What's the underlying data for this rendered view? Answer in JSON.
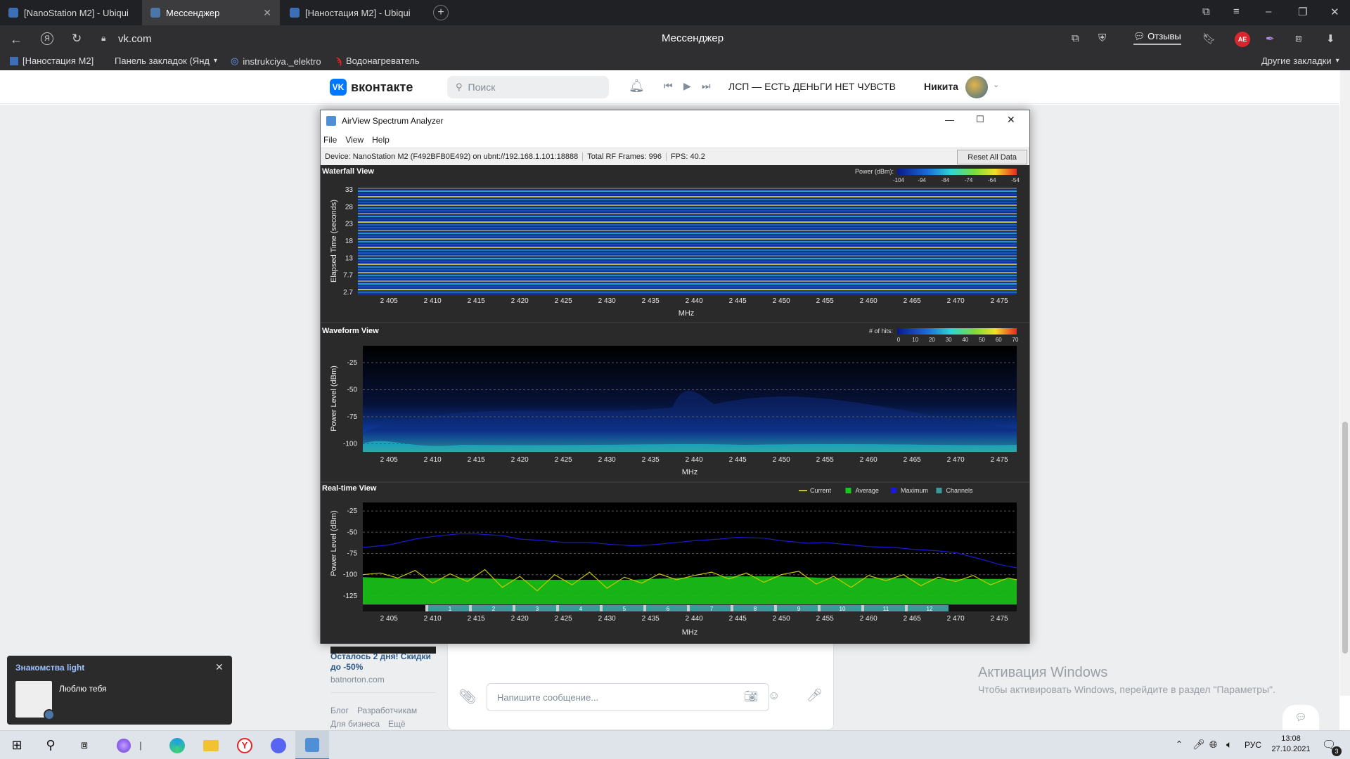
{
  "browser": {
    "tabs": [
      {
        "label": "[NanoStation M2] - Ubiqui",
        "active": false
      },
      {
        "label": "Мессенджер",
        "active": true
      },
      {
        "label": "[Наностация M2] - Ubiqui",
        "active": false
      }
    ],
    "address": "vk.com",
    "page_title": "Мессенджер",
    "feedback": "Отзывы",
    "badge": "AE",
    "bookmarks": [
      "[Наностация M2]",
      "Панель закладок (Янд",
      "instrukciya._elektro",
      "Водонагреватель"
    ],
    "other_bookmarks": "Другие закладки"
  },
  "vk": {
    "logo": "вконтакте",
    "search_placeholder": "Поиск",
    "track": "ЛСП — ЕСТЬ ДЕНЬГИ НЕТ ЧУВСТВ",
    "user_name": "Никита",
    "ad_title": "Осталось 2 дня! Скидки до -50%",
    "ad_domain": "batnorton.com",
    "footer": [
      "Блог",
      "Разработчикам",
      "Для бизнеса",
      "Ещё"
    ],
    "message_placeholder": "Напишите сообщение..."
  },
  "app": {
    "title": "AirView Spectrum Analyzer",
    "menu": [
      "File",
      "View",
      "Help"
    ],
    "device": "Device: NanoStation M2 (F492BFB0E492) on ubnt://192.168.1.101:18888",
    "frames": "Total RF Frames: 996",
    "fps": "FPS: 40.2",
    "reset": "Reset All Data",
    "waterfall_title": "Waterfall View",
    "waveform_title": "Waveform View",
    "realtime_title": "Real-time View",
    "power_label": "Power (dBm):",
    "hits_label": "# of hits:",
    "mhz": "MHz"
  },
  "chart_data": [
    {
      "type": "heatmap",
      "title": "Waterfall View",
      "xlabel": "MHz",
      "ylabel": "Elapsed Time (seconds)",
      "x_ticks": [
        "2 405",
        "2 410",
        "2 415",
        "2 420",
        "2 425",
        "2 430",
        "2 435",
        "2 440",
        "2 445",
        "2 450",
        "2 455",
        "2 460",
        "2 465",
        "2 470",
        "2 475"
      ],
      "y_ticks": [
        "33",
        "28",
        "23",
        "18",
        "13",
        "7.7",
        "2.7"
      ],
      "legend_label": "Power (dBm):",
      "legend_ticks": [
        "-104",
        "-94",
        "-84",
        "-74",
        "-64",
        "-54"
      ]
    },
    {
      "type": "heatmap",
      "title": "Waveform View",
      "xlabel": "MHz",
      "ylabel": "Power Level (dBm)",
      "x_ticks": [
        "2 405",
        "2 410",
        "2 415",
        "2 420",
        "2 425",
        "2 430",
        "2 435",
        "2 440",
        "2 445",
        "2 450",
        "2 455",
        "2 460",
        "2 465",
        "2 470",
        "2 475"
      ],
      "y_ticks": [
        "-25",
        "-50",
        "-75",
        "-100"
      ],
      "legend_label": "# of hits:",
      "legend_ticks": [
        "0",
        "10",
        "20",
        "30",
        "40",
        "50",
        "60",
        "70"
      ]
    },
    {
      "type": "line",
      "title": "Real-time View",
      "xlabel": "MHz",
      "ylabel": "Power Level (dBm)",
      "x_ticks": [
        "2 405",
        "2 410",
        "2 415",
        "2 420",
        "2 425",
        "2 430",
        "2 435",
        "2 440",
        "2 445",
        "2 450",
        "2 455",
        "2 460",
        "2 465",
        "2 470",
        "2 475"
      ],
      "y_ticks": [
        "-25",
        "-50",
        "-75",
        "-100",
        "-125"
      ],
      "legend": [
        "Current",
        "Average",
        "Maximum",
        "Channels"
      ],
      "channels": [
        "1",
        "2",
        "3",
        "4",
        "5",
        "6",
        "7",
        "8",
        "9",
        "10",
        "11",
        "12"
      ],
      "xlim": [
        2402,
        2477
      ],
      "ylim": [
        -135,
        -15
      ],
      "series": [
        {
          "name": "Maximum",
          "x": [
            2402,
            2405,
            2408,
            2410,
            2413,
            2415,
            2418,
            2420,
            2423,
            2425,
            2428,
            2430,
            2433,
            2435,
            2438,
            2440,
            2443,
            2445,
            2448,
            2450,
            2453,
            2455,
            2458,
            2460,
            2463,
            2465,
            2468,
            2470,
            2473,
            2475,
            2477
          ],
          "y": [
            -68,
            -65,
            -58,
            -55,
            -52,
            -52,
            -54,
            -58,
            -60,
            -62,
            -62,
            -64,
            -66,
            -65,
            -62,
            -60,
            -58,
            -56,
            -57,
            -60,
            -63,
            -62,
            -65,
            -67,
            -68,
            -70,
            -72,
            -74,
            -82,
            -88,
            -92
          ]
        },
        {
          "name": "Average",
          "x": [
            2402,
            2405,
            2408,
            2410,
            2413,
            2415,
            2418,
            2420,
            2423,
            2425,
            2428,
            2430,
            2433,
            2435,
            2438,
            2440,
            2443,
            2445,
            2448,
            2450,
            2453,
            2455,
            2458,
            2460,
            2463,
            2465,
            2468,
            2470,
            2473,
            2475,
            2477
          ],
          "y": [
            -103,
            -104,
            -105,
            -104,
            -104,
            -104,
            -105,
            -106,
            -106,
            -106,
            -106,
            -106,
            -106,
            -105,
            -104,
            -103,
            -102,
            -102,
            -102,
            -102,
            -103,
            -104,
            -104,
            -104,
            -104,
            -104,
            -105,
            -105,
            -105,
            -105,
            -105
          ]
        },
        {
          "name": "Current",
          "x": [
            2402,
            2404,
            2406,
            2408,
            2410,
            2412,
            2414,
            2416,
            2418,
            2420,
            2422,
            2424,
            2426,
            2428,
            2430,
            2432,
            2434,
            2436,
            2438,
            2440,
            2442,
            2444,
            2446,
            2448,
            2450,
            2452,
            2454,
            2456,
            2458,
            2460,
            2462,
            2464,
            2466,
            2468,
            2470,
            2472,
            2474,
            2476,
            2477
          ],
          "y": [
            -100,
            -98,
            -104,
            -95,
            -110,
            -99,
            -108,
            -94,
            -115,
            -102,
            -119,
            -100,
            -112,
            -97,
            -116,
            -103,
            -110,
            -99,
            -106,
            -101,
            -97,
            -105,
            -98,
            -109,
            -100,
            -96,
            -111,
            -102,
            -115,
            -101,
            -107,
            -100,
            -113,
            -103,
            -108,
            -101,
            -112,
            -104,
            -106
          ]
        }
      ]
    }
  ],
  "notification": {
    "title": "Знакомства light",
    "text": "Люблю тебя"
  },
  "windows": {
    "watermark_title": "Активация Windows",
    "watermark_text": "Чтобы активировать Windows, перейдите в раздел \"Параметры\"."
  },
  "taskbar": {
    "lang": "РУС",
    "time": "13:08",
    "date": "27.10.2021",
    "notif_count": "3"
  }
}
